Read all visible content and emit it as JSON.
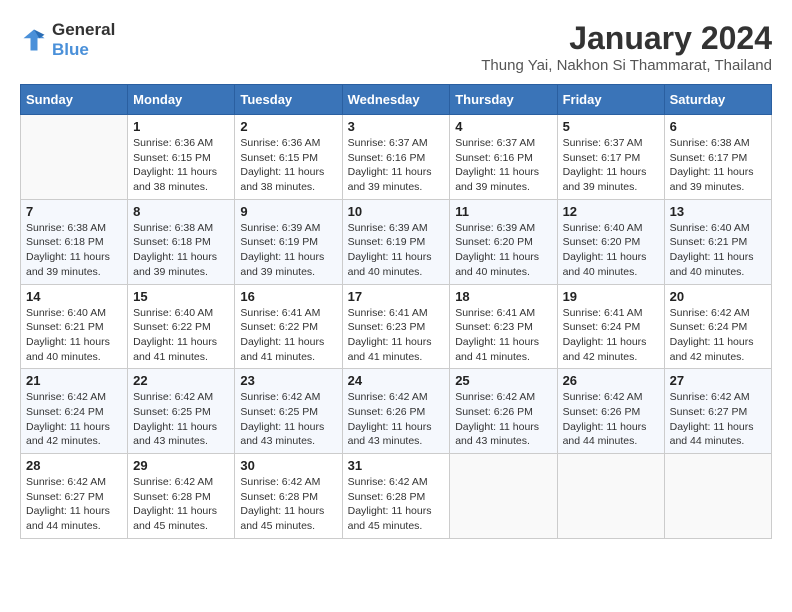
{
  "header": {
    "logo_line1": "General",
    "logo_line2": "Blue",
    "month_year": "January 2024",
    "location": "Thung Yai, Nakhon Si Thammarat, Thailand"
  },
  "weekdays": [
    "Sunday",
    "Monday",
    "Tuesday",
    "Wednesday",
    "Thursday",
    "Friday",
    "Saturday"
  ],
  "weeks": [
    [
      {
        "day": "",
        "text": ""
      },
      {
        "day": "1",
        "text": "Sunrise: 6:36 AM\nSunset: 6:15 PM\nDaylight: 11 hours\nand 38 minutes."
      },
      {
        "day": "2",
        "text": "Sunrise: 6:36 AM\nSunset: 6:15 PM\nDaylight: 11 hours\nand 38 minutes."
      },
      {
        "day": "3",
        "text": "Sunrise: 6:37 AM\nSunset: 6:16 PM\nDaylight: 11 hours\nand 39 minutes."
      },
      {
        "day": "4",
        "text": "Sunrise: 6:37 AM\nSunset: 6:16 PM\nDaylight: 11 hours\nand 39 minutes."
      },
      {
        "day": "5",
        "text": "Sunrise: 6:37 AM\nSunset: 6:17 PM\nDaylight: 11 hours\nand 39 minutes."
      },
      {
        "day": "6",
        "text": "Sunrise: 6:38 AM\nSunset: 6:17 PM\nDaylight: 11 hours\nand 39 minutes."
      }
    ],
    [
      {
        "day": "7",
        "text": "Sunrise: 6:38 AM\nSunset: 6:18 PM\nDaylight: 11 hours\nand 39 minutes."
      },
      {
        "day": "8",
        "text": "Sunrise: 6:38 AM\nSunset: 6:18 PM\nDaylight: 11 hours\nand 39 minutes."
      },
      {
        "day": "9",
        "text": "Sunrise: 6:39 AM\nSunset: 6:19 PM\nDaylight: 11 hours\nand 39 minutes."
      },
      {
        "day": "10",
        "text": "Sunrise: 6:39 AM\nSunset: 6:19 PM\nDaylight: 11 hours\nand 40 minutes."
      },
      {
        "day": "11",
        "text": "Sunrise: 6:39 AM\nSunset: 6:20 PM\nDaylight: 11 hours\nand 40 minutes."
      },
      {
        "day": "12",
        "text": "Sunrise: 6:40 AM\nSunset: 6:20 PM\nDaylight: 11 hours\nand 40 minutes."
      },
      {
        "day": "13",
        "text": "Sunrise: 6:40 AM\nSunset: 6:21 PM\nDaylight: 11 hours\nand 40 minutes."
      }
    ],
    [
      {
        "day": "14",
        "text": "Sunrise: 6:40 AM\nSunset: 6:21 PM\nDaylight: 11 hours\nand 40 minutes."
      },
      {
        "day": "15",
        "text": "Sunrise: 6:40 AM\nSunset: 6:22 PM\nDaylight: 11 hours\nand 41 minutes."
      },
      {
        "day": "16",
        "text": "Sunrise: 6:41 AM\nSunset: 6:22 PM\nDaylight: 11 hours\nand 41 minutes."
      },
      {
        "day": "17",
        "text": "Sunrise: 6:41 AM\nSunset: 6:23 PM\nDaylight: 11 hours\nand 41 minutes."
      },
      {
        "day": "18",
        "text": "Sunrise: 6:41 AM\nSunset: 6:23 PM\nDaylight: 11 hours\nand 41 minutes."
      },
      {
        "day": "19",
        "text": "Sunrise: 6:41 AM\nSunset: 6:24 PM\nDaylight: 11 hours\nand 42 minutes."
      },
      {
        "day": "20",
        "text": "Sunrise: 6:42 AM\nSunset: 6:24 PM\nDaylight: 11 hours\nand 42 minutes."
      }
    ],
    [
      {
        "day": "21",
        "text": "Sunrise: 6:42 AM\nSunset: 6:24 PM\nDaylight: 11 hours\nand 42 minutes."
      },
      {
        "day": "22",
        "text": "Sunrise: 6:42 AM\nSunset: 6:25 PM\nDaylight: 11 hours\nand 43 minutes."
      },
      {
        "day": "23",
        "text": "Sunrise: 6:42 AM\nSunset: 6:25 PM\nDaylight: 11 hours\nand 43 minutes."
      },
      {
        "day": "24",
        "text": "Sunrise: 6:42 AM\nSunset: 6:26 PM\nDaylight: 11 hours\nand 43 minutes."
      },
      {
        "day": "25",
        "text": "Sunrise: 6:42 AM\nSunset: 6:26 PM\nDaylight: 11 hours\nand 43 minutes."
      },
      {
        "day": "26",
        "text": "Sunrise: 6:42 AM\nSunset: 6:26 PM\nDaylight: 11 hours\nand 44 minutes."
      },
      {
        "day": "27",
        "text": "Sunrise: 6:42 AM\nSunset: 6:27 PM\nDaylight: 11 hours\nand 44 minutes."
      }
    ],
    [
      {
        "day": "28",
        "text": "Sunrise: 6:42 AM\nSunset: 6:27 PM\nDaylight: 11 hours\nand 44 minutes."
      },
      {
        "day": "29",
        "text": "Sunrise: 6:42 AM\nSunset: 6:28 PM\nDaylight: 11 hours\nand 45 minutes."
      },
      {
        "day": "30",
        "text": "Sunrise: 6:42 AM\nSunset: 6:28 PM\nDaylight: 11 hours\nand 45 minutes."
      },
      {
        "day": "31",
        "text": "Sunrise: 6:42 AM\nSunset: 6:28 PM\nDaylight: 11 hours\nand 45 minutes."
      },
      {
        "day": "",
        "text": ""
      },
      {
        "day": "",
        "text": ""
      },
      {
        "day": "",
        "text": ""
      }
    ]
  ]
}
